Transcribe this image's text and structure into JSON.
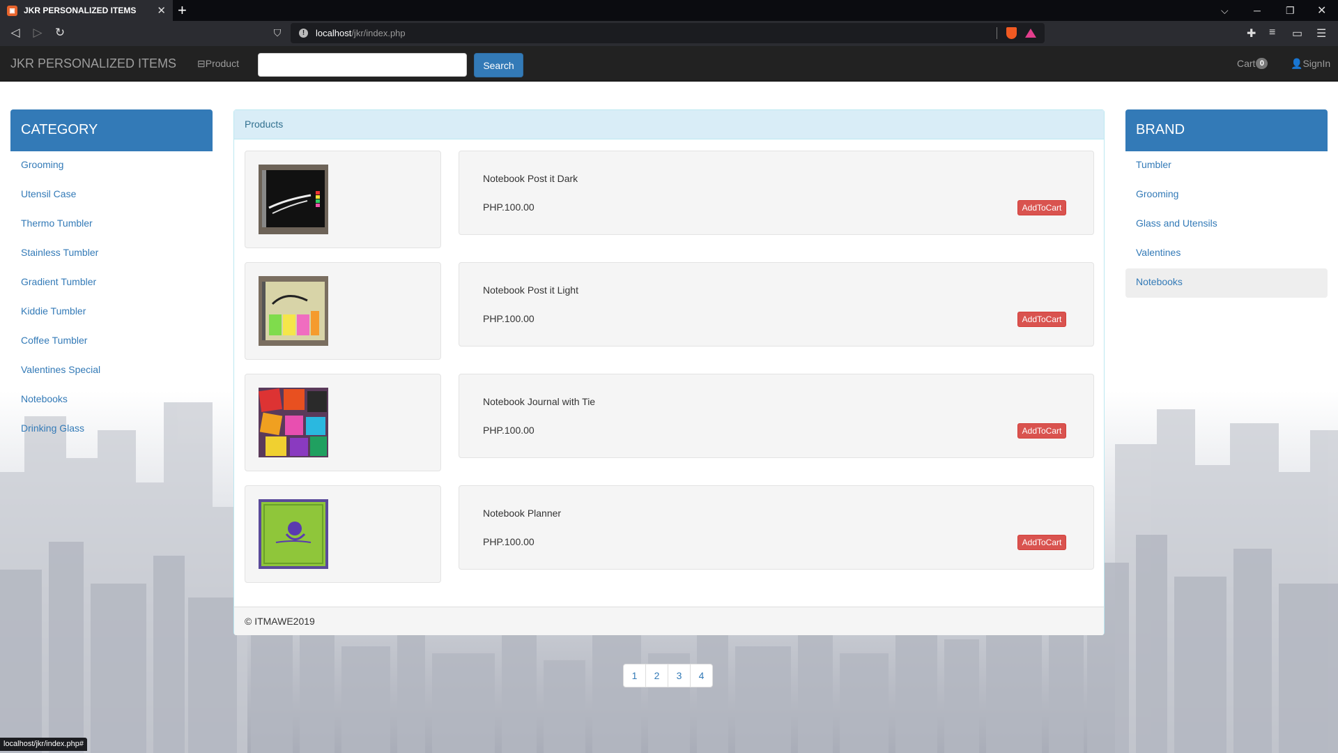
{
  "browser": {
    "tab_title": "JKR PERSONALIZED ITEMS",
    "url_host": "localhost",
    "url_path": "/jkr/index.php",
    "status_url": "localhost/jkr/index.php#"
  },
  "navbar": {
    "brand": "JKR PERSONALIZED ITEMS",
    "product_link": "Product",
    "search_placeholder": "",
    "search_button": "Search",
    "cart_label": "Cart",
    "cart_count": "0",
    "signin_label": "SignIn"
  },
  "category": {
    "title": "CATEGORY",
    "items": [
      {
        "label": "Grooming"
      },
      {
        "label": "Utensil Case"
      },
      {
        "label": "Thermo Tumbler"
      },
      {
        "label": "Stainless Tumbler"
      },
      {
        "label": "Gradient Tumbler"
      },
      {
        "label": "Kiddie Tumbler"
      },
      {
        "label": "Coffee Tumbler"
      },
      {
        "label": "Valentines Special"
      },
      {
        "label": "Notebooks"
      },
      {
        "label": "Drinking Glass"
      }
    ]
  },
  "brand": {
    "title": "BRAND",
    "active": "Notebooks",
    "items": [
      {
        "label": "Tumbler"
      },
      {
        "label": "Grooming"
      },
      {
        "label": "Glass and Utensils"
      },
      {
        "label": "Valentines"
      },
      {
        "label": "Notebooks"
      }
    ]
  },
  "products": {
    "heading": "Products",
    "add_label": "AddToCart",
    "items": [
      {
        "name": "Notebook Post it Dark",
        "price": "PHP.100.00"
      },
      {
        "name": "Notebook Post it Light",
        "price": "PHP.100.00"
      },
      {
        "name": "Notebook Journal with Tie",
        "price": "PHP.100.00"
      },
      {
        "name": "Notebook Planner",
        "price": "PHP.100.00"
      }
    ],
    "footer": "© ITMAWE2019"
  },
  "pagination": {
    "pages": [
      "1",
      "2",
      "3",
      "4"
    ]
  },
  "colors": {
    "primary": "#337ab7",
    "danger": "#d9534f",
    "navbar": "#222222",
    "panel_heading": "#d9edf7"
  }
}
